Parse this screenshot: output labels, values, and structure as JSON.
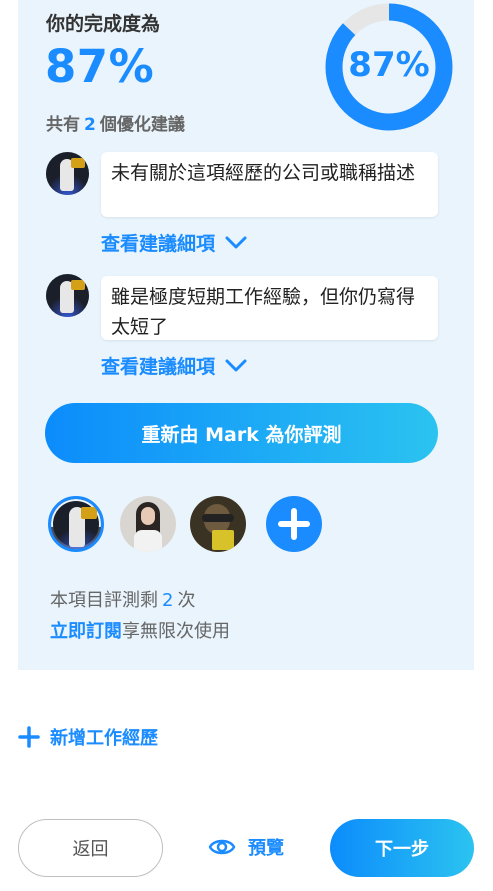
{
  "completion": {
    "title": "你的完成度為",
    "percent_label": "87%",
    "percent_value": 0.87,
    "ring_label": "87%",
    "suggestion_prefix": "共有",
    "suggestion_count": "2",
    "suggestion_suffix": "個優化建議"
  },
  "suggestions": [
    {
      "text": "未有關於這項經歷的公司或職稱描述",
      "detail_link": "查看建議細項"
    },
    {
      "text": "雖是極度短期工作經驗，但你仍寫得太短了",
      "detail_link": "查看建議細項"
    }
  ],
  "remeasure_button": "重新由 Mark 為你評測",
  "evaluations": {
    "remaining_prefix": "本項目評測剩",
    "remaining_count": "2",
    "remaining_suffix": "次",
    "subscribe_link": "立即訂閱",
    "subscribe_suffix": "享無限次使用"
  },
  "add_experience": "新增工作經歷",
  "footer": {
    "back": "返回",
    "preview": "預覽",
    "next": "下一步"
  },
  "colors": {
    "accent": "#1a8cff",
    "card_bg": "#e9f4fc",
    "ring_track": "#e6e6e6"
  }
}
